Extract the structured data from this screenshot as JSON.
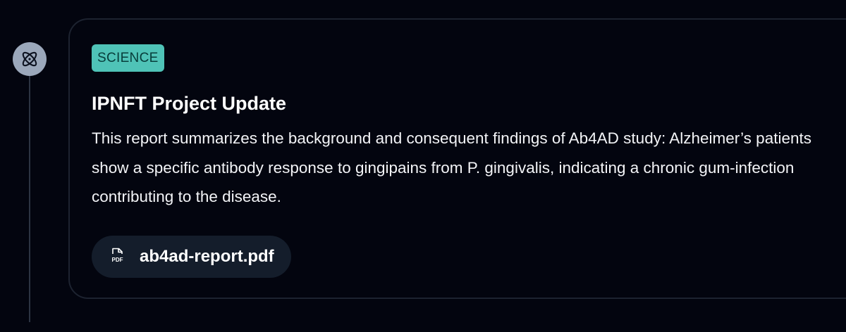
{
  "timeline": {
    "icon": "atom-icon"
  },
  "post": {
    "tag": "SCIENCE",
    "title": "IPNFT Project Update",
    "summary": "This report summarizes the background and consequent findings of Ab4AD study: Alzheimer’s patients show a specific antibody response to gingipains from P. gingivalis, indicating a chronic gum-infection contributing to the disease.",
    "attachment": {
      "icon": "pdf-file-icon",
      "icon_label": "PDF",
      "file_name": "ab4ad-report.pdf"
    }
  },
  "colors": {
    "background": "#03050f",
    "tag_background": "#4fc3b7",
    "chip_background": "#141d2b",
    "timeline_icon_background": "#9ba8bb"
  }
}
